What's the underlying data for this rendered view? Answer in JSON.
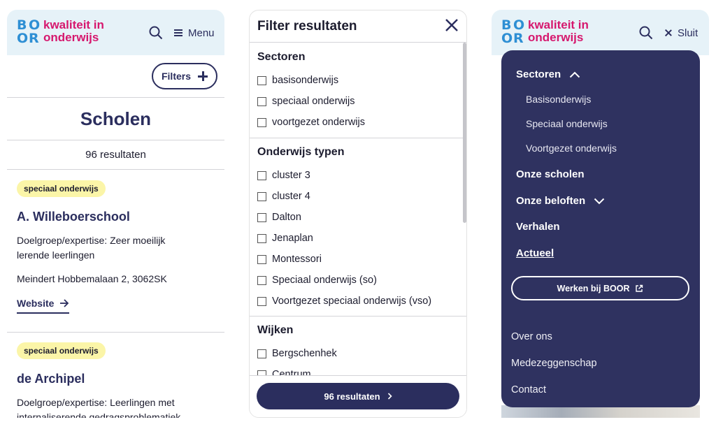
{
  "brand": {
    "letters": [
      "B",
      "O",
      "O",
      "R"
    ],
    "name_line1": "kwaliteit in",
    "name_line2": "onderwijs"
  },
  "colors": {
    "navy": "#2b2e5e",
    "pink": "#d6186e",
    "blue": "#2e8fd4",
    "tag_yellow": "#fbf5a8",
    "header_bg": "#e6f2f8"
  },
  "panel1": {
    "menu_label": "Menu",
    "filters_label": "Filters",
    "title": "Scholen",
    "result_count": "96 resultaten",
    "schools": [
      {
        "tag": "speciaal onderwijs",
        "name": "A. Willeboerschool",
        "desc": "Doelgroep/expertise: Zeer moeilijk lerende leerlingen",
        "address": "Meindert Hobbemalaan 2, 3062SK",
        "link": "Website"
      },
      {
        "tag": "speciaal onderwijs",
        "name": "de Archipel",
        "desc": "Doelgroep/expertise: Leerlingen met internaliserende gedragsproblematiek"
      }
    ]
  },
  "panel2": {
    "title": "Filter resultaten",
    "sections": [
      {
        "title": "Sectoren",
        "options": [
          "basisonderwijs",
          "speciaal onderwijs",
          "voortgezet onderwijs"
        ]
      },
      {
        "title": "Onderwijs typen",
        "options": [
          "cluster 3",
          "cluster 4",
          "Dalton",
          "Jenaplan",
          "Montessori",
          "Speciaal onderwijs (so)",
          "Voortgezet speciaal onderwijs (vso)"
        ]
      },
      {
        "title": "Wijken",
        "options": [
          "Bergschenhek",
          "Centrum"
        ]
      }
    ],
    "results_button": "96 resultaten"
  },
  "panel3": {
    "close_label": "Sluit",
    "sectoren": "Sectoren",
    "sub_items": [
      "Basisonderwijs",
      "Speciaal onderwijs",
      "Voortgezet onderwijs"
    ],
    "onze_scholen": "Onze scholen",
    "onze_beloften": "Onze beloften",
    "verhalen": "Verhalen",
    "actueel": "Actueel",
    "werken_button": "Werken bij BOOR",
    "links": [
      "Over ons",
      "Medezeggenschap",
      "Contact"
    ]
  }
}
